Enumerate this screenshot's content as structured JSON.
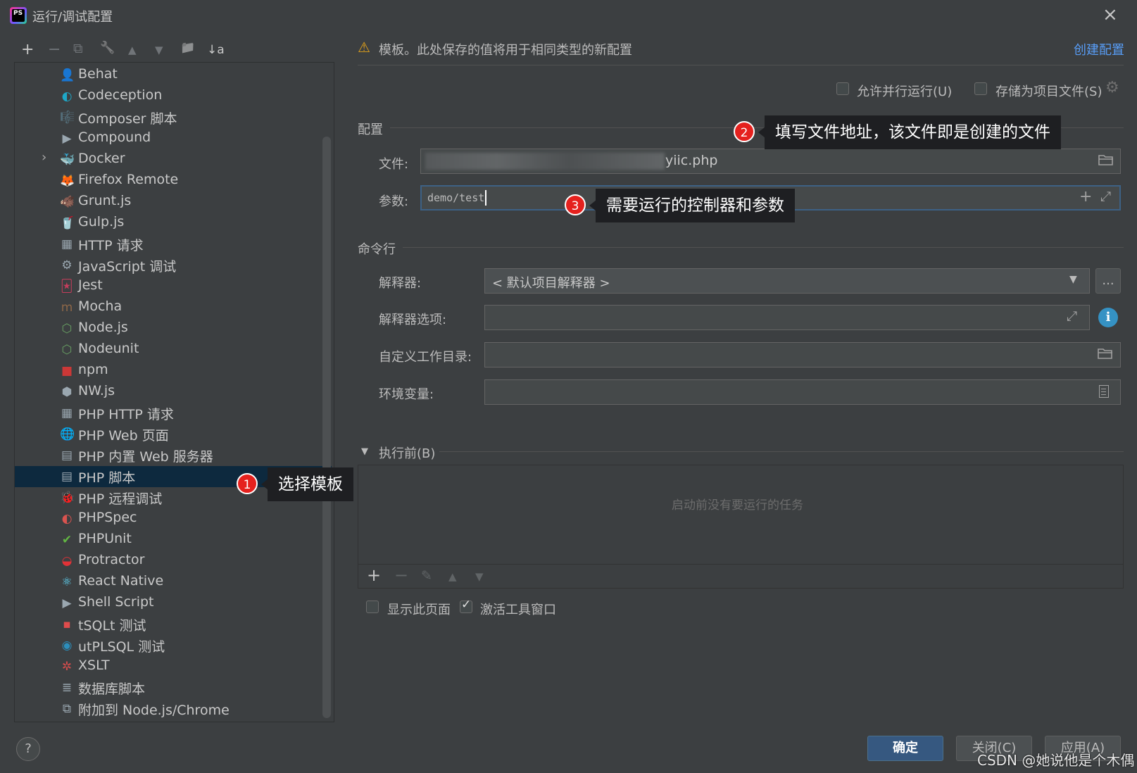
{
  "window": {
    "title": "运行/调试配置",
    "logo_text": "PS",
    "close_icon": "×"
  },
  "toolbar": {
    "add": "+",
    "remove": "−",
    "copy": "⧉",
    "wrench": "🔧",
    "up": "▲",
    "down": "▼",
    "folder": "📁",
    "sort": "↓a"
  },
  "tree": {
    "items": [
      {
        "label": "Behat",
        "icon": "person-icon",
        "glyph": "👤",
        "color": "#9aa7b0"
      },
      {
        "label": "Codeception",
        "icon": "codeception-icon",
        "glyph": "◐",
        "color": "#1ea7c7"
      },
      {
        "label": "Composer 脚本",
        "icon": "composer-icon",
        "glyph": "🎼",
        "color": "#b38d6b"
      },
      {
        "label": "Compound",
        "icon": "compound-icon",
        "glyph": "▶",
        "color": "#9aa7b0"
      },
      {
        "label": "Docker",
        "icon": "docker-icon",
        "glyph": "🐳",
        "color": "#2496ed",
        "expandable": true
      },
      {
        "label": "Firefox Remote",
        "icon": "firefox-icon",
        "glyph": "🦊",
        "color": "#ff7139"
      },
      {
        "label": "Grunt.js",
        "icon": "grunt-icon",
        "glyph": "🐗",
        "color": "#e48632"
      },
      {
        "label": "Gulp.js",
        "icon": "gulp-icon",
        "glyph": "🥤",
        "color": "#cf4647"
      },
      {
        "label": "HTTP 请求",
        "icon": "http-api-icon",
        "glyph": "▦",
        "color": "#9aa7b0"
      },
      {
        "label": "JavaScript 调试",
        "icon": "js-debug-icon",
        "glyph": "⚙",
        "color": "#9aa7b0"
      },
      {
        "label": "Jest",
        "icon": "jest-icon",
        "glyph": "🃏",
        "color": "#c63d5c"
      },
      {
        "label": "Mocha",
        "icon": "mocha-icon",
        "glyph": "m",
        "color": "#8d6748"
      },
      {
        "label": "Node.js",
        "icon": "nodejs-icon",
        "glyph": "⬡",
        "color": "#68a063"
      },
      {
        "label": "Nodeunit",
        "icon": "nodeunit-icon",
        "glyph": "⬡",
        "color": "#68a063"
      },
      {
        "label": "npm",
        "icon": "npm-icon",
        "glyph": "■",
        "color": "#cb3837"
      },
      {
        "label": "NW.js",
        "icon": "nwjs-icon",
        "glyph": "⬢",
        "color": "#9aa7b0"
      },
      {
        "label": "PHP HTTP 请求",
        "icon": "php-http-icon",
        "glyph": "▦",
        "color": "#9aa7b0"
      },
      {
        "label": "PHP Web 页面",
        "icon": "php-web-icon",
        "glyph": "🌐",
        "color": "#9aa7b0"
      },
      {
        "label": "PHP 内置 Web 服务器",
        "icon": "php-server-icon",
        "glyph": "▤",
        "color": "#9aa7b0"
      },
      {
        "label": "PHP 脚本",
        "icon": "php-script-icon",
        "glyph": "▤",
        "color": "#9aa7b0",
        "selected": true
      },
      {
        "label": "PHP 远程调试",
        "icon": "php-remote-debug-icon",
        "glyph": "🐞",
        "color": "#9aa7b0"
      },
      {
        "label": "PHPSpec",
        "icon": "phpspec-icon",
        "glyph": "◐",
        "color": "#d9534f"
      },
      {
        "label": "PHPUnit",
        "icon": "phpunit-icon",
        "glyph": "✔",
        "color": "#62b543"
      },
      {
        "label": "Protractor",
        "icon": "protractor-icon",
        "glyph": "◒",
        "color": "#e23237"
      },
      {
        "label": "React Native",
        "icon": "react-icon",
        "glyph": "⚛",
        "color": "#61dafb"
      },
      {
        "label": "Shell Script",
        "icon": "shell-icon",
        "glyph": "▶",
        "color": "#9aa7b0"
      },
      {
        "label": "tSQLt 测试",
        "icon": "tsqlt-icon",
        "glyph": "▪",
        "color": "#e04c4c"
      },
      {
        "label": "utPLSQL 测试",
        "icon": "utplsql-icon",
        "glyph": "◉",
        "color": "#2c8ebb"
      },
      {
        "label": "XSLT",
        "icon": "xslt-icon",
        "glyph": "✲",
        "color": "#d24c4c"
      },
      {
        "label": "数据库脚本",
        "icon": "database-icon",
        "glyph": "≣",
        "color": "#9aa7b0"
      },
      {
        "label": "附加到 Node.js/Chrome",
        "icon": "attach-icon",
        "glyph": "⧉",
        "color": "#9aa7b0"
      }
    ]
  },
  "help": {
    "glyph": "?"
  },
  "header": {
    "warning_icon": "⚠",
    "warning_text": "模板。此处保存的值将用于相同类型的新配置",
    "create_link": "创建配置"
  },
  "options": {
    "allow_parallel": "允许并行运行(U)",
    "store_as_file": "存储为项目文件(S)",
    "gear": "⚙"
  },
  "config": {
    "section": "配置",
    "file_label": "文件:",
    "file_value": "yiic.php",
    "args_label": "参数:",
    "args_value": "demo/test"
  },
  "cmd": {
    "section": "命令行",
    "interpreter_label": "解释器:",
    "interpreter_value": "< 默认项目解释器 >",
    "more_button": "...",
    "interp_options_label": "解释器选项:",
    "workdir_label": "自定义工作目录:",
    "env_label": "环境变量:"
  },
  "before": {
    "section": "执行前(B)",
    "empty_text": "启动前没有要运行的任务",
    "add": "+",
    "remove": "−",
    "edit": "✎",
    "up": "▲",
    "down": "▼"
  },
  "bottom_options": {
    "show_page": "显示此页面",
    "activate_tool": "激活工具窗口",
    "activate_checked": true
  },
  "annotations": {
    "a1": {
      "num": "1",
      "text": "选择模板"
    },
    "a2": {
      "num": "2",
      "text": "填写文件地址，该文件即是创建的文件"
    },
    "a3": {
      "num": "3",
      "text": "需要运行的控制器和参数"
    }
  },
  "buttons": {
    "ok": "确定",
    "close": "关闭(C)",
    "apply": "应用(A)"
  },
  "watermark": "CSDN @她说他是个木偶",
  "colors": {
    "accent": "#365880",
    "link": "#589df6",
    "badge": "#e5211e",
    "selected_row": "#0d293e"
  }
}
